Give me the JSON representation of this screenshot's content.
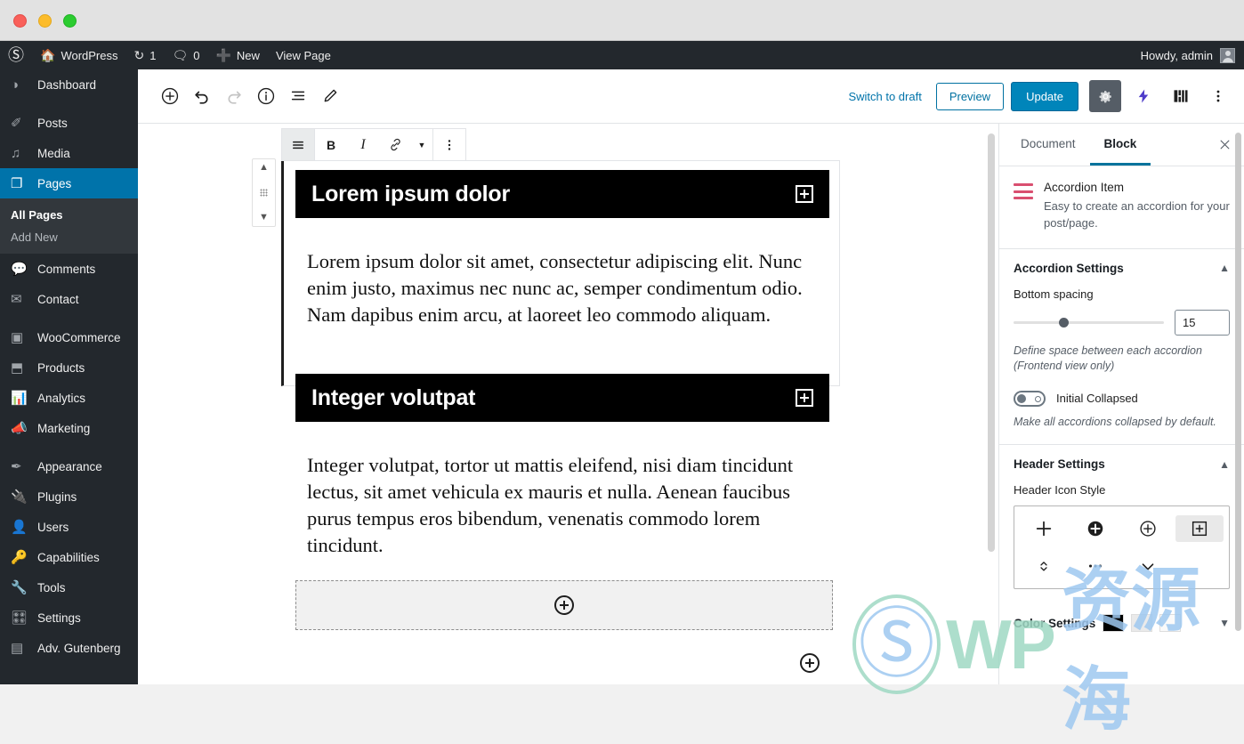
{
  "window": {
    "traffic_lights": [
      "close",
      "minimize",
      "maximize"
    ]
  },
  "adminbar": {
    "logo_icon": "wordpress-logo-icon",
    "site_name": "WordPress",
    "site_icon": "home-icon",
    "updates_icon": "updates-icon",
    "updates_count": "1",
    "comments_icon": "comment-icon",
    "comments_count": "0",
    "new_icon": "plus-icon",
    "new_label": "New",
    "view_page_label": "View Page",
    "howdy": "Howdy, admin"
  },
  "sidebar": {
    "items": [
      {
        "label": "Dashboard",
        "icon": "dashboard-icon",
        "glyph": "◑",
        "current": false
      },
      {
        "label": "Posts",
        "icon": "pin-icon",
        "glyph": "✐",
        "current": false
      },
      {
        "label": "Media",
        "icon": "media-icon",
        "glyph": "♪",
        "current": false
      },
      {
        "label": "Pages",
        "icon": "page-icon",
        "glyph": "❐",
        "current": true
      },
      {
        "label": "Comments",
        "icon": "comment-icon",
        "glyph": "⌨",
        "current": false
      },
      {
        "label": "Contact",
        "icon": "envelope-icon",
        "glyph": "✉",
        "current": false
      },
      {
        "label": "WooCommerce",
        "icon": "woocommerce-icon",
        "glyph": "▣",
        "current": false
      },
      {
        "label": "Products",
        "icon": "box-icon",
        "glyph": "⬒",
        "current": false
      },
      {
        "label": "Analytics",
        "icon": "chart-bars-icon",
        "glyph": "▐",
        "current": false
      },
      {
        "label": "Marketing",
        "icon": "megaphone-icon",
        "glyph": "◤",
        "current": false
      },
      {
        "label": "Appearance",
        "icon": "paintbrush-icon",
        "glyph": "✒",
        "current": false
      },
      {
        "label": "Plugins",
        "icon": "plug-icon",
        "glyph": "⚡",
        "current": false
      },
      {
        "label": "Users",
        "icon": "user-icon",
        "glyph": "☻",
        "current": false
      },
      {
        "label": "Capabilities",
        "icon": "key-icon",
        "glyph": "⚿",
        "current": false
      },
      {
        "label": "Tools",
        "icon": "wrench-icon",
        "glyph": "⚒",
        "current": false
      },
      {
        "label": "Settings",
        "icon": "sliders-icon",
        "glyph": "⚙",
        "current": false
      },
      {
        "label": "Adv. Gutenberg",
        "icon": "blocks-icon",
        "glyph": "▤",
        "current": false
      }
    ],
    "submenu": {
      "parent": "Pages",
      "items": [
        {
          "label": "All Pages",
          "active": true
        },
        {
          "label": "Add New",
          "active": false
        }
      ]
    }
  },
  "editor_header": {
    "left_tools": [
      {
        "name": "add-block-button",
        "glyph": "⊕",
        "disabled": false
      },
      {
        "name": "undo-button",
        "glyph": "↶",
        "disabled": false
      },
      {
        "name": "redo-button",
        "glyph": "↷",
        "disabled": true
      },
      {
        "name": "content-info-button",
        "glyph": "ⓘ",
        "disabled": false
      },
      {
        "name": "block-navigation-button",
        "glyph": "☰",
        "disabled": false
      },
      {
        "name": "edit-mode-button",
        "glyph": "✎",
        "disabled": false
      }
    ],
    "switch_to_draft": "Switch to draft",
    "preview": "Preview",
    "update": "Update",
    "settings_gear_icon": "gear-icon",
    "bolt_icon": "bolt-icon",
    "blocks_icon": "blocks-icon",
    "more_menu_icon": "ellipsis-vertical-icon"
  },
  "block_toolbar": {
    "block_type_icon": "paragraph-block-icon",
    "bold_label": "B",
    "italic_label": "I",
    "link_icon": "link-icon",
    "more_formats_icon": "chevron-down-icon",
    "more_options_icon": "ellipsis-vertical-icon"
  },
  "block_mover": {
    "up_icon": "chevron-up-icon",
    "drag_icon": "drag-handle-icon",
    "down_icon": "chevron-down-icon"
  },
  "content": {
    "accordions": [
      {
        "title": "Lorem ipsum dolor",
        "toggle_icon": "plus-square-icon",
        "body": "Lorem ipsum dolor sit amet, consectetur adipiscing elit. Nunc enim justo, maximus nec nunc ac, semper condimentum odio. Nam dapibus enim arcu, at laoreet leo commodo aliquam."
      },
      {
        "title": "Integer volutpat",
        "toggle_icon": "plus-square-icon",
        "body": "Integer volutpat, tortor ut mattis eleifend, nisi diam tincidunt lectus, sit amet vehicula ex mauris et nulla. Aenean faucibus purus tempus eros bibendum, venenatis commodo lorem tincidunt."
      }
    ],
    "appender_icon": "circle-plus-icon",
    "global_appender_icon": "circle-plus-icon"
  },
  "settings_panel": {
    "tabs": [
      {
        "label": "Document",
        "active": false
      },
      {
        "label": "Block",
        "active": true
      }
    ],
    "close_icon": "close-icon",
    "block_card": {
      "icon": "accordion-item-icon",
      "title": "Accordion Item",
      "description": "Easy to create an accordion for your post/page."
    },
    "accordion_settings": {
      "heading": "Accordion Settings",
      "collapse_icon": "chevron-up-icon",
      "bottom_spacing_label": "Bottom spacing",
      "bottom_spacing_value": "15",
      "bottom_spacing_help": "Define space between each accordion (Frontend view only)",
      "initial_collapsed_label": "Initial Collapsed",
      "initial_collapsed_help": "Make all accordions collapsed by default.",
      "initial_collapsed_state": "off"
    },
    "header_settings": {
      "heading": "Header Settings",
      "collapse_icon": "chevron-up-icon",
      "icon_style_label": "Header Icon Style",
      "icon_choices": [
        {
          "name": "plus-icon",
          "glyph": "＋",
          "selected": false
        },
        {
          "name": "plus-circle-filled-icon",
          "glyph": "⊕",
          "selected": false
        },
        {
          "name": "plus-circle-outline-icon",
          "glyph": "⊕",
          "selected": false
        },
        {
          "name": "plus-square-icon",
          "glyph": "⊞",
          "selected": true
        },
        {
          "name": "chevron-updown-icon",
          "glyph": "⌃",
          "selected": false
        },
        {
          "name": "ellipsis-icon",
          "glyph": "…",
          "selected": false
        },
        {
          "name": "chevron-down-icon",
          "glyph": "⌄",
          "selected": false
        }
      ]
    },
    "color_settings": {
      "heading": "Color Settings",
      "swatches": [
        "#000000",
        "#eaeaea",
        "#fafafa"
      ],
      "expand_icon": "chevron-down-icon"
    }
  },
  "watermark": {
    "logo_icon": "wordpress-logo-icon",
    "text_latin": "WP",
    "text_cjk": "资源海"
  },
  "colors": {
    "wp_admin_dark": "#23282d",
    "wp_blue": "#0073aa",
    "accent_blue": "#0085ba",
    "accordion_black": "#000000",
    "block_icon_pink": "#d94f70"
  }
}
